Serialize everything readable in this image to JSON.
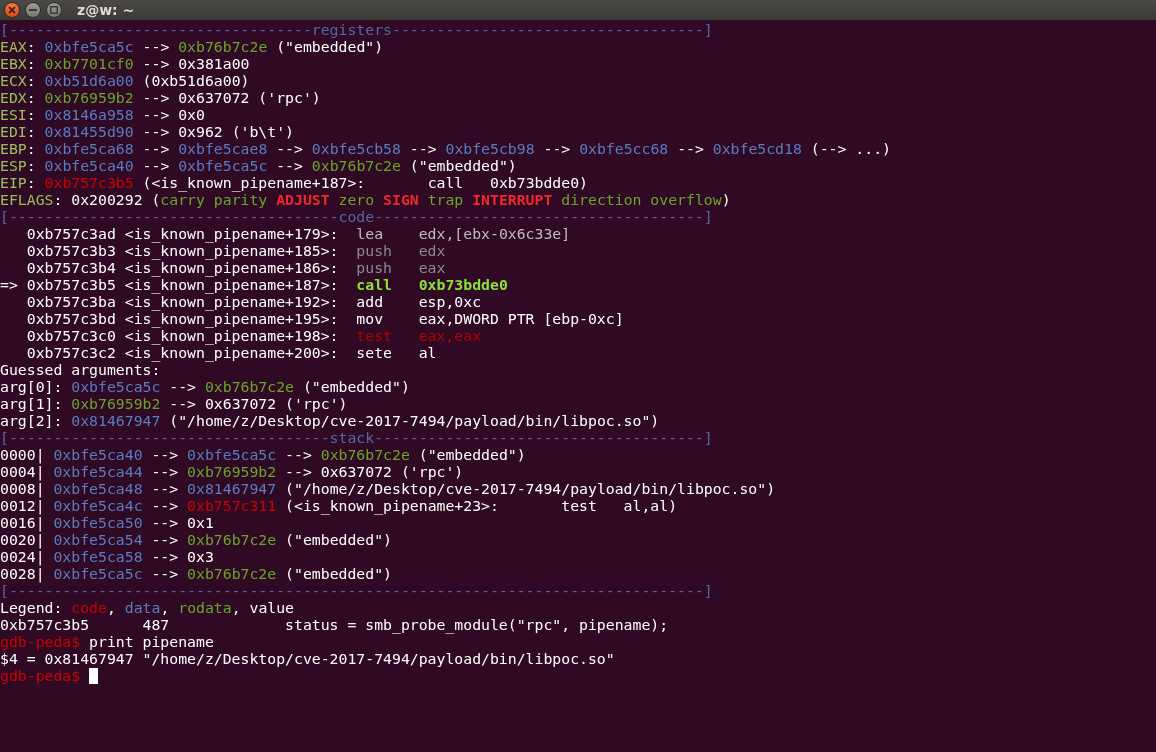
{
  "window": {
    "title": "z@w: ~"
  },
  "lines": [
    {
      "segments": [
        {
          "text": "[----------------------------------registers-----------------------------------]",
          "kind": "frame"
        }
      ]
    },
    {
      "segments": [
        {
          "text": "EAX",
          "kind": "reg"
        },
        {
          "text": ": ",
          "kind": "value"
        },
        {
          "text": "0xbfe5ca5c",
          "kind": "data"
        },
        {
          "text": " --> ",
          "kind": "value"
        },
        {
          "text": "0xb76b7c2e",
          "kind": "rodata"
        },
        {
          "text": " (\"embedded\")",
          "kind": "value"
        }
      ]
    },
    {
      "segments": [
        {
          "text": "EBX",
          "kind": "reg"
        },
        {
          "text": ": ",
          "kind": "value"
        },
        {
          "text": "0xb7701cf0",
          "kind": "rodata"
        },
        {
          "text": " --> 0x381a00",
          "kind": "value"
        }
      ]
    },
    {
      "segments": [
        {
          "text": "ECX",
          "kind": "reg"
        },
        {
          "text": ": ",
          "kind": "value"
        },
        {
          "text": "0xb51d6a00",
          "kind": "data"
        },
        {
          "text": " (0xb51d6a00)",
          "kind": "value"
        }
      ]
    },
    {
      "segments": [
        {
          "text": "EDX",
          "kind": "reg"
        },
        {
          "text": ": ",
          "kind": "value"
        },
        {
          "text": "0xb76959b2",
          "kind": "rodata"
        },
        {
          "text": " --> 0x637072 ('rpc')",
          "kind": "value"
        }
      ]
    },
    {
      "segments": [
        {
          "text": "ESI",
          "kind": "reg"
        },
        {
          "text": ": ",
          "kind": "value"
        },
        {
          "text": "0x8146a958",
          "kind": "data"
        },
        {
          "text": " --> 0x0",
          "kind": "value"
        }
      ]
    },
    {
      "segments": [
        {
          "text": "EDI",
          "kind": "reg"
        },
        {
          "text": ": ",
          "kind": "value"
        },
        {
          "text": "0x81455d90",
          "kind": "data"
        },
        {
          "text": " --> 0x962 ('b\\t')",
          "kind": "value"
        }
      ]
    },
    {
      "segments": [
        {
          "text": "EBP",
          "kind": "reg"
        },
        {
          "text": ": ",
          "kind": "value"
        },
        {
          "text": "0xbfe5ca68",
          "kind": "data"
        },
        {
          "text": " --> ",
          "kind": "value"
        },
        {
          "text": "0xbfe5cae8",
          "kind": "data"
        },
        {
          "text": " --> ",
          "kind": "value"
        },
        {
          "text": "0xbfe5cb58",
          "kind": "data"
        },
        {
          "text": " --> ",
          "kind": "value"
        },
        {
          "text": "0xbfe5cb98",
          "kind": "data"
        },
        {
          "text": " --> ",
          "kind": "value"
        },
        {
          "text": "0xbfe5cc68",
          "kind": "data"
        },
        {
          "text": " --> ",
          "kind": "value"
        },
        {
          "text": "0xbfe5cd18",
          "kind": "data"
        },
        {
          "text": " (--> ...)",
          "kind": "value"
        }
      ]
    },
    {
      "segments": [
        {
          "text": "ESP",
          "kind": "reg"
        },
        {
          "text": ": ",
          "kind": "value"
        },
        {
          "text": "0xbfe5ca40",
          "kind": "data"
        },
        {
          "text": " --> ",
          "kind": "value"
        },
        {
          "text": "0xbfe5ca5c",
          "kind": "data"
        },
        {
          "text": " --> ",
          "kind": "value"
        },
        {
          "text": "0xb76b7c2e",
          "kind": "rodata"
        },
        {
          "text": " (\"embedded\")",
          "kind": "value"
        }
      ]
    },
    {
      "segments": [
        {
          "text": "EIP",
          "kind": "reg"
        },
        {
          "text": ": ",
          "kind": "value"
        },
        {
          "text": "0xb757c3b5",
          "kind": "code"
        },
        {
          "text": " (<is_known_pipename+187>:       call   0xb73bdde0)",
          "kind": "value"
        }
      ]
    },
    {
      "segments": [
        {
          "text": "EFLAGS",
          "kind": "reg"
        },
        {
          "text": ": 0x200292 (",
          "kind": "value"
        },
        {
          "text": "carry parity ",
          "kind": "flag"
        },
        {
          "text": "ADJUST",
          "kind": "flagset"
        },
        {
          "text": " zero ",
          "kind": "flag"
        },
        {
          "text": "SIGN",
          "kind": "flagset"
        },
        {
          "text": " trap ",
          "kind": "flag"
        },
        {
          "text": "INTERRUPT",
          "kind": "flagset"
        },
        {
          "text": " direction overflow",
          "kind": "flag"
        },
        {
          "text": ")",
          "kind": "value"
        }
      ]
    },
    {
      "segments": [
        {
          "text": "[-------------------------------------code-------------------------------------]",
          "kind": "frame"
        }
      ]
    },
    {
      "segments": [
        {
          "text": "   0xb757c3ad <is_known_pipename+179>:  ",
          "kind": "value"
        },
        {
          "text": "lea    edx,[ebx-0x6c33e]",
          "kind": "faint"
        }
      ]
    },
    {
      "segments": [
        {
          "text": "   0xb757c3b3 <is_known_pipename+185>:  ",
          "kind": "value"
        },
        {
          "text": "push   edx",
          "kind": "fainter"
        }
      ]
    },
    {
      "segments": [
        {
          "text": "   0xb757c3b4 <is_known_pipename+186>:  ",
          "kind": "value"
        },
        {
          "text": "push   eax",
          "kind": "fainter"
        }
      ]
    },
    {
      "segments": [
        {
          "text": "=> 0xb757c3b5 <is_known_pipename+187>:  ",
          "kind": "value"
        },
        {
          "text": "call   0xb73bdde0",
          "kind": "current"
        }
      ]
    },
    {
      "segments": [
        {
          "text": "   0xb757c3ba <is_known_pipename+192>:  add    esp,0xc",
          "kind": "value"
        }
      ]
    },
    {
      "segments": [
        {
          "text": "   0xb757c3bd <is_known_pipename+195>:  mov    eax,DWORD PTR [ebp-0xc]",
          "kind": "value"
        }
      ]
    },
    {
      "segments": [
        {
          "text": "   0xb757c3c0 <is_known_pipename+198>:  ",
          "kind": "value"
        },
        {
          "text": "test   eax,eax",
          "kind": "branch"
        }
      ]
    },
    {
      "segments": [
        {
          "text": "   0xb757c3c2 <is_known_pipename+200>:  sete   al",
          "kind": "value"
        }
      ]
    },
    {
      "segments": [
        {
          "text": "Guessed arguments:",
          "kind": "value"
        }
      ]
    },
    {
      "segments": [
        {
          "text": "arg[0]: ",
          "kind": "value"
        },
        {
          "text": "0xbfe5ca5c",
          "kind": "data"
        },
        {
          "text": " --> ",
          "kind": "value"
        },
        {
          "text": "0xb76b7c2e",
          "kind": "rodata"
        },
        {
          "text": " (\"embedded\")",
          "kind": "value"
        }
      ]
    },
    {
      "segments": [
        {
          "text": "arg[1]: ",
          "kind": "value"
        },
        {
          "text": "0xb76959b2",
          "kind": "rodata"
        },
        {
          "text": " --> 0x637072 ('rpc')",
          "kind": "value"
        }
      ]
    },
    {
      "segments": [
        {
          "text": "arg[2]: ",
          "kind": "value"
        },
        {
          "text": "0x81467947",
          "kind": "data"
        },
        {
          "text": " (\"/home/z/Desktop/cve-2017-7494/payload/bin/libpoc.so\")",
          "kind": "value"
        }
      ]
    },
    {
      "segments": [
        {
          "text": "[------------------------------------stack-------------------------------------]",
          "kind": "frame"
        }
      ]
    },
    {
      "segments": [
        {
          "text": "0000| ",
          "kind": "value"
        },
        {
          "text": "0xbfe5ca40",
          "kind": "data"
        },
        {
          "text": " --> ",
          "kind": "value"
        },
        {
          "text": "0xbfe5ca5c",
          "kind": "data"
        },
        {
          "text": " --> ",
          "kind": "value"
        },
        {
          "text": "0xb76b7c2e",
          "kind": "rodata"
        },
        {
          "text": " (\"embedded\")",
          "kind": "value"
        }
      ]
    },
    {
      "segments": [
        {
          "text": "0004| ",
          "kind": "value"
        },
        {
          "text": "0xbfe5ca44",
          "kind": "data"
        },
        {
          "text": " --> ",
          "kind": "value"
        },
        {
          "text": "0xb76959b2",
          "kind": "rodata"
        },
        {
          "text": " --> 0x637072 ('rpc')",
          "kind": "value"
        }
      ]
    },
    {
      "segments": [
        {
          "text": "0008| ",
          "kind": "value"
        },
        {
          "text": "0xbfe5ca48",
          "kind": "data"
        },
        {
          "text": " --> ",
          "kind": "value"
        },
        {
          "text": "0x81467947",
          "kind": "data"
        },
        {
          "text": " (\"/home/z/Desktop/cve-2017-7494/payload/bin/libpoc.so\")",
          "kind": "value"
        }
      ]
    },
    {
      "segments": [
        {
          "text": "0012| ",
          "kind": "value"
        },
        {
          "text": "0xbfe5ca4c",
          "kind": "data"
        },
        {
          "text": " --> ",
          "kind": "value"
        },
        {
          "text": "0xb757c311",
          "kind": "code"
        },
        {
          "text": " (<is_known_pipename+23>:       test   al,al)",
          "kind": "value"
        }
      ]
    },
    {
      "segments": [
        {
          "text": "0016| ",
          "kind": "value"
        },
        {
          "text": "0xbfe5ca50",
          "kind": "data"
        },
        {
          "text": " --> 0x1",
          "kind": "value"
        }
      ]
    },
    {
      "segments": [
        {
          "text": "0020| ",
          "kind": "value"
        },
        {
          "text": "0xbfe5ca54",
          "kind": "data"
        },
        {
          "text": " --> ",
          "kind": "value"
        },
        {
          "text": "0xb76b7c2e",
          "kind": "rodata"
        },
        {
          "text": " (\"embedded\")",
          "kind": "value"
        }
      ]
    },
    {
      "segments": [
        {
          "text": "0024| ",
          "kind": "value"
        },
        {
          "text": "0xbfe5ca58",
          "kind": "data"
        },
        {
          "text": " --> 0x3",
          "kind": "value"
        }
      ]
    },
    {
      "segments": [
        {
          "text": "0028| ",
          "kind": "value"
        },
        {
          "text": "0xbfe5ca5c",
          "kind": "data"
        },
        {
          "text": " --> ",
          "kind": "value"
        },
        {
          "text": "0xb76b7c2e",
          "kind": "rodata"
        },
        {
          "text": " (\"embedded\")",
          "kind": "value"
        }
      ]
    },
    {
      "segments": [
        {
          "text": "[------------------------------------------------------------------------------]",
          "kind": "frame"
        }
      ]
    },
    {
      "segments": [
        {
          "text": "Legend: ",
          "kind": "value"
        },
        {
          "text": "code",
          "kind": "code"
        },
        {
          "text": ", ",
          "kind": "value"
        },
        {
          "text": "data",
          "kind": "data"
        },
        {
          "text": ", ",
          "kind": "value"
        },
        {
          "text": "rodata",
          "kind": "rodata"
        },
        {
          "text": ", value",
          "kind": "value"
        }
      ]
    },
    {
      "segments": [
        {
          "text": "0xb757c3b5      487             status = smb_probe_module(\"rpc\", pipename);",
          "kind": "value"
        }
      ]
    },
    {
      "segments": [
        {
          "text": "gdb-peda$",
          "kind": "prompt"
        },
        {
          "text": " print pipename",
          "kind": "value"
        }
      ]
    },
    {
      "segments": [
        {
          "text": "$4 = 0x81467947 \"/home/z/Desktop/cve-2017-7494/payload/bin/libpoc.so\"",
          "kind": "value"
        }
      ]
    },
    {
      "segments": [
        {
          "text": "gdb-peda$",
          "kind": "prompt"
        }
      ],
      "cursor": true
    }
  ]
}
